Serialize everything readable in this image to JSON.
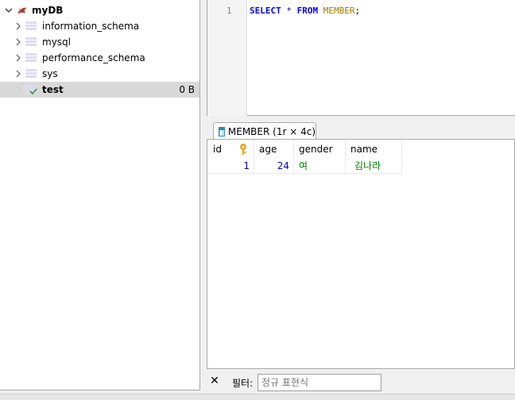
{
  "tree": {
    "root": {
      "label": "myDB"
    },
    "items": [
      {
        "label": "information_schema"
      },
      {
        "label": "mysql"
      },
      {
        "label": "performance_schema"
      },
      {
        "label": "sys"
      },
      {
        "label": "test",
        "size": "0 B",
        "selected": true
      }
    ]
  },
  "editor": {
    "line_number": "1",
    "tokens": {
      "select": "SELECT",
      "star": " * ",
      "from": "FROM",
      "table": " MEMBER",
      "semi": ";"
    }
  },
  "result_tab": {
    "label": "MEMBER (1r × 4c)"
  },
  "grid": {
    "columns": [
      "id",
      "age",
      "gender",
      "name"
    ],
    "rows": [
      {
        "id": "1",
        "age": "24",
        "gender": "여",
        "name": "김나라"
      }
    ]
  },
  "filter": {
    "label": "필터:",
    "placeholder": "정규 표현식",
    "close_glyph": "✕"
  },
  "colors": {
    "accent": "#1e88c8",
    "key": "#f0a500",
    "number": "#0000cc",
    "text_value": "#008000"
  }
}
